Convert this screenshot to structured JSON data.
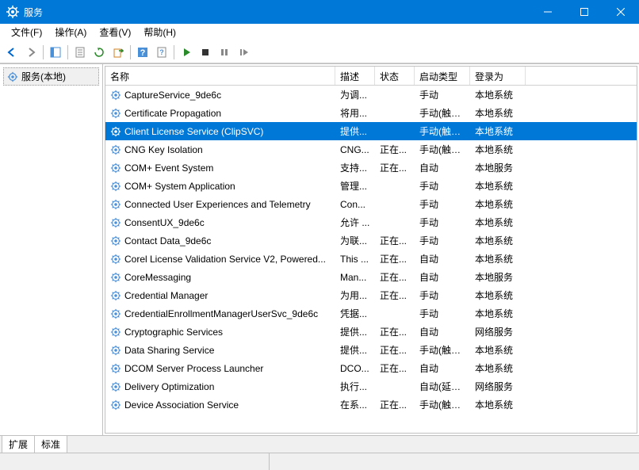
{
  "window": {
    "title": "服务"
  },
  "menu": {
    "file": "文件(F)",
    "action": "操作(A)",
    "view": "查看(V)",
    "help": "帮助(H)"
  },
  "sidebar": {
    "root": "服务(本地)"
  },
  "columns": {
    "name": "名称",
    "desc": "描述",
    "status": "状态",
    "start": "启动类型",
    "logon": "登录为"
  },
  "tabs": {
    "extended": "扩展",
    "standard": "标准"
  },
  "selected_index": 2,
  "services": [
    {
      "name": "CaptureService_9de6c",
      "desc": "为调...",
      "status": "",
      "start": "手动",
      "logon": "本地系统"
    },
    {
      "name": "Certificate Propagation",
      "desc": "将用...",
      "status": "",
      "start": "手动(触发...",
      "logon": "本地系统"
    },
    {
      "name": "Client License Service (ClipSVC)",
      "desc": "提供...",
      "status": "",
      "start": "手动(触发...",
      "logon": "本地系统"
    },
    {
      "name": "CNG Key Isolation",
      "desc": "CNG...",
      "status": "正在...",
      "start": "手动(触发...",
      "logon": "本地系统"
    },
    {
      "name": "COM+ Event System",
      "desc": "支持...",
      "status": "正在...",
      "start": "自动",
      "logon": "本地服务"
    },
    {
      "name": "COM+ System Application",
      "desc": "管理...",
      "status": "",
      "start": "手动",
      "logon": "本地系统"
    },
    {
      "name": "Connected User Experiences and Telemetry",
      "desc": "Con...",
      "status": "",
      "start": "手动",
      "logon": "本地系统"
    },
    {
      "name": "ConsentUX_9de6c",
      "desc": "允许 ...",
      "status": "",
      "start": "手动",
      "logon": "本地系统"
    },
    {
      "name": "Contact Data_9de6c",
      "desc": "为联...",
      "status": "正在...",
      "start": "手动",
      "logon": "本地系统"
    },
    {
      "name": "Corel License Validation Service V2, Powered...",
      "desc": "This ...",
      "status": "正在...",
      "start": "自动",
      "logon": "本地系统"
    },
    {
      "name": "CoreMessaging",
      "desc": "Man...",
      "status": "正在...",
      "start": "自动",
      "logon": "本地服务"
    },
    {
      "name": "Credential Manager",
      "desc": "为用...",
      "status": "正在...",
      "start": "手动",
      "logon": "本地系统"
    },
    {
      "name": "CredentialEnrollmentManagerUserSvc_9de6c",
      "desc": "凭据...",
      "status": "",
      "start": "手动",
      "logon": "本地系统"
    },
    {
      "name": "Cryptographic Services",
      "desc": "提供...",
      "status": "正在...",
      "start": "自动",
      "logon": "网络服务"
    },
    {
      "name": "Data Sharing Service",
      "desc": "提供...",
      "status": "正在...",
      "start": "手动(触发...",
      "logon": "本地系统"
    },
    {
      "name": "DCOM Server Process Launcher",
      "desc": "DCO...",
      "status": "正在...",
      "start": "自动",
      "logon": "本地系统"
    },
    {
      "name": "Delivery Optimization",
      "desc": "执行...",
      "status": "",
      "start": "自动(延迟...",
      "logon": "网络服务"
    },
    {
      "name": "Device Association Service",
      "desc": "在系...",
      "status": "正在...",
      "start": "手动(触发...",
      "logon": "本地系统"
    }
  ]
}
